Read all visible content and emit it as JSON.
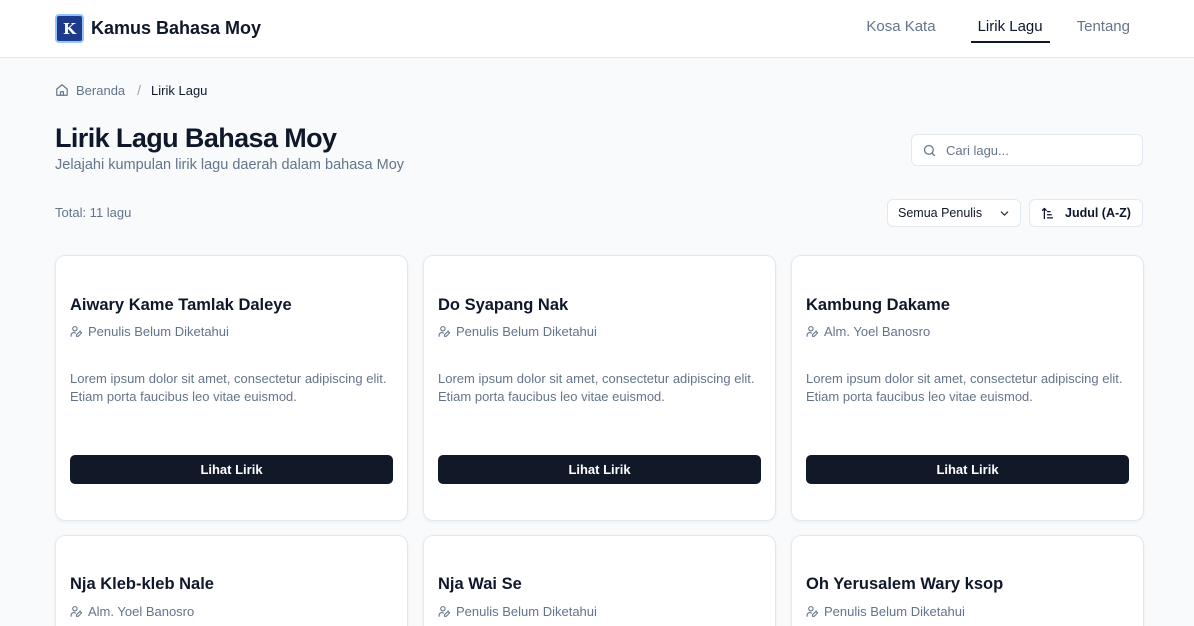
{
  "header": {
    "brand_letter": "K",
    "brand_name": "Kamus Bahasa Moy",
    "nav": [
      {
        "label": "Kosa Kata",
        "active": false
      },
      {
        "label": "Lirik Lagu",
        "active": true
      },
      {
        "label": "Tentang",
        "active": false
      }
    ]
  },
  "breadcrumb": {
    "home_label": "Beranda",
    "separator": "/",
    "current": "Lirik Lagu"
  },
  "page": {
    "title": "Lirik Lagu Bahasa Moy",
    "subtitle": "Jelajahi kumpulan lirik lagu daerah dalam bahasa Moy",
    "search_placeholder": "Cari lagu...",
    "total_label": "Total: 11 lagu",
    "filter_label": "Semua Penulis",
    "sort_label": "Judul (A-Z)"
  },
  "songs": [
    {
      "title": "Aiwary Kame Tamlak Daleye",
      "author": "Penulis Belum Diketahui",
      "description": "Lorem ipsum dolor sit amet, consectetur adipiscing elit. Etiam porta faucibus leo vitae euismod.",
      "button": "Lihat Lirik"
    },
    {
      "title": "Do Syapang Nak",
      "author": "Penulis Belum Diketahui",
      "description": "Lorem ipsum dolor sit amet, consectetur adipiscing elit. Etiam porta faucibus leo vitae euismod.",
      "button": "Lihat Lirik"
    },
    {
      "title": "Kambung Dakame",
      "author": "Alm. Yoel Banosro",
      "description": "Lorem ipsum dolor sit amet, consectetur adipiscing elit. Etiam porta faucibus leo vitae euismod.",
      "button": "Lihat Lirik"
    },
    {
      "title": "Nja Kleb-kleb Nale",
      "author": "Alm. Yoel Banosro"
    },
    {
      "title": "Nja Wai Se",
      "author": "Penulis Belum Diketahui"
    },
    {
      "title": "Oh Yerusalem Wary ksop",
      "author": "Penulis Belum Diketahui"
    }
  ],
  "colors": {
    "background": "#f8fafc",
    "primary_button": "#111827",
    "muted_text": "#64748b",
    "border": "#e2e8f0"
  }
}
